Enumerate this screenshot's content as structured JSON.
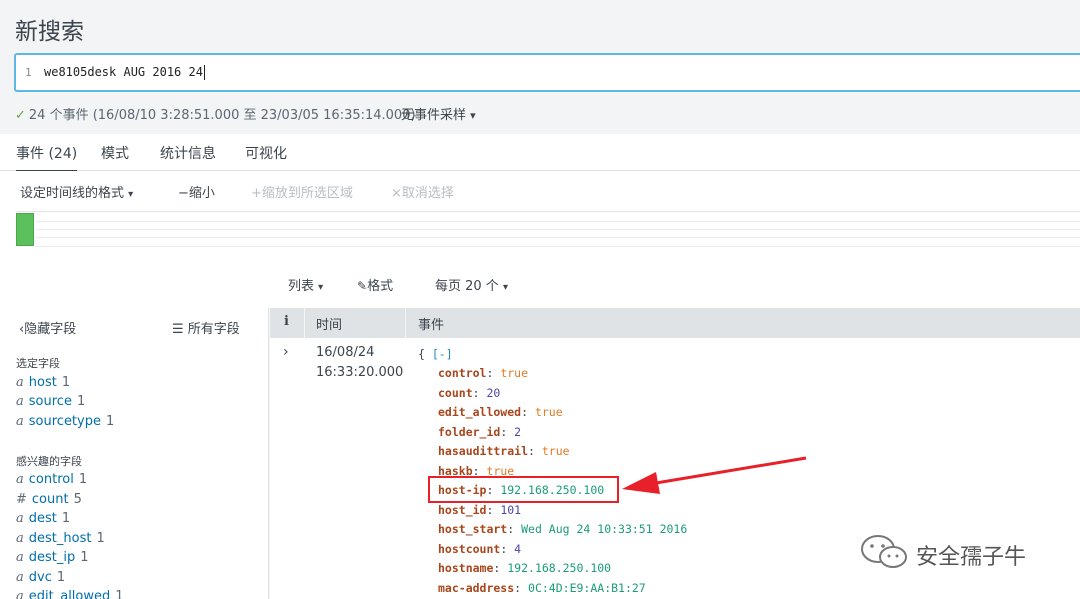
{
  "page": {
    "title": "新搜索"
  },
  "search": {
    "line_number": "1",
    "query": "we8105desk AUG 2016 24"
  },
  "summary": {
    "checkmark": "✓",
    "text": "24 个事件 (16/08/10 3:28:51.000 至 23/03/05 16:35:14.000)",
    "sampling_label": "无事件采样",
    "sampling_caret": "▾"
  },
  "tabs": [
    {
      "label": "事件 (24)",
      "active": true
    },
    {
      "label": "模式"
    },
    {
      "label": "统计信息"
    },
    {
      "label": "可视化"
    }
  ],
  "timeline": {
    "format_label": "设定时间线的格式",
    "zoom_out_label": "−缩小",
    "zoom_selection_label": "+缩放到所选区域",
    "deselect_label": "×取消选择"
  },
  "results_toolbar": {
    "list_label": "列表",
    "format_label": "格式",
    "per_page_label": "每页 20 个"
  },
  "sidebar": {
    "hide_fields_label": "隐藏字段",
    "all_fields_label": "所有字段",
    "selected_section": "选定字段",
    "selected_fields": [
      {
        "type": "a",
        "name": "host",
        "count": "1"
      },
      {
        "type": "a",
        "name": "source",
        "count": "1"
      },
      {
        "type": "a",
        "name": "sourcetype",
        "count": "1"
      }
    ],
    "interesting_section": "感兴趣的字段",
    "interesting_fields": [
      {
        "type": "a",
        "name": "control",
        "count": "1"
      },
      {
        "type": "#",
        "name": "count",
        "count": "5"
      },
      {
        "type": "a",
        "name": "dest",
        "count": "1"
      },
      {
        "type": "a",
        "name": "dest_host",
        "count": "1"
      },
      {
        "type": "a",
        "name": "dest_ip",
        "count": "1"
      },
      {
        "type": "a",
        "name": "dvc",
        "count": "1"
      },
      {
        "type": "a",
        "name": "edit_allowed",
        "count": "1"
      }
    ]
  },
  "table": {
    "col_info": "i",
    "col_time": "时间",
    "col_event": "事件",
    "row": {
      "time_line1": "16/08/24",
      "time_line2": "16:33:20.000",
      "open_brace": "{",
      "collapse": "[-]",
      "fields": [
        {
          "key": "control",
          "value": "true",
          "kind": "bool"
        },
        {
          "key": "count",
          "value": "20",
          "kind": "num"
        },
        {
          "key": "edit_allowed",
          "value": "true",
          "kind": "bool"
        },
        {
          "key": "folder_id",
          "value": "2",
          "kind": "num"
        },
        {
          "key": "hasaudittrail",
          "value": "true",
          "kind": "bool"
        },
        {
          "key": "haskb",
          "value": "true",
          "kind": "bool"
        },
        {
          "key": "host-ip",
          "value": "192.168.250.100",
          "kind": "str"
        },
        {
          "key": "host_id",
          "value": "101",
          "kind": "num"
        },
        {
          "key": "host_start",
          "value": "Wed Aug 24 10:33:51 2016",
          "kind": "str"
        },
        {
          "key": "hostcount",
          "value": "4",
          "kind": "num"
        },
        {
          "key": "hostname",
          "value": "192.168.250.100",
          "kind": "str"
        },
        {
          "key": "mac-address",
          "value": "0C:4D:E9:AA:B1:27",
          "kind": "str"
        }
      ]
    }
  },
  "watermark": {
    "text": "安全孺子牛"
  },
  "colors": {
    "accent": "#5fb7e5",
    "highlight": "#e8202a",
    "timeline_bar": "#5cc05c"
  }
}
